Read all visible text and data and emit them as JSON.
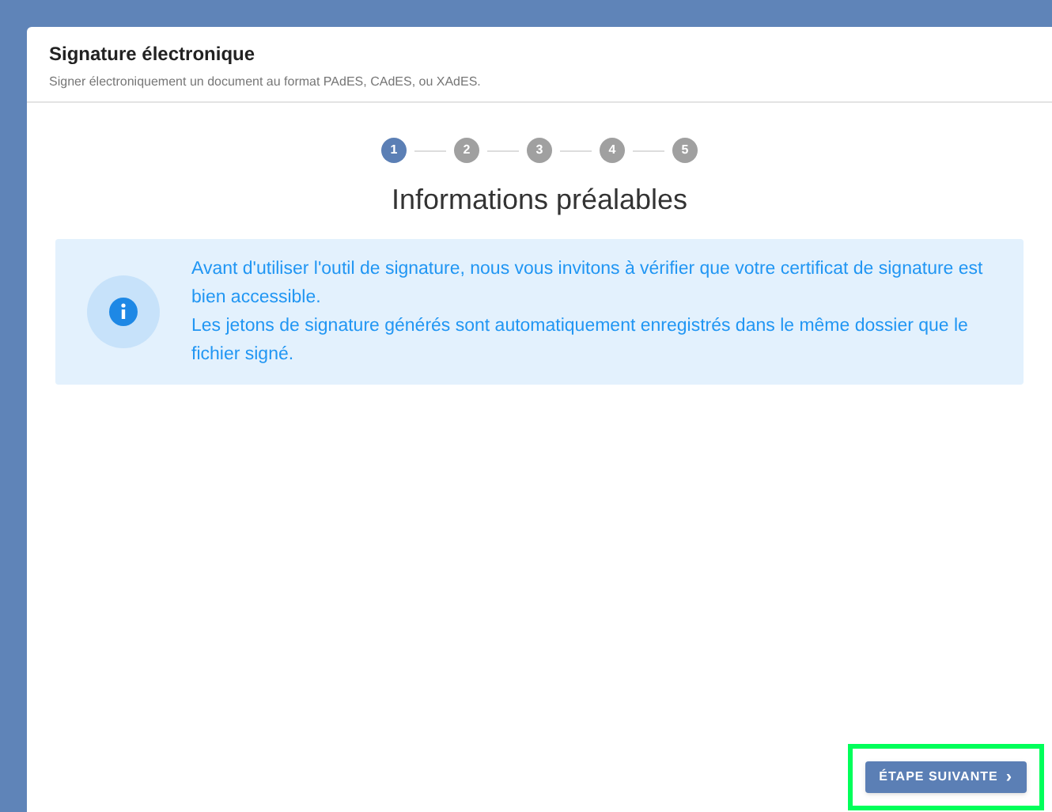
{
  "panel": {
    "title": "Signature électronique",
    "subtitle": "Signer électroniquement un document au format PAdES, CAdES, ou XAdES."
  },
  "steps": [
    {
      "label": "1",
      "selected": true
    },
    {
      "label": "2",
      "selected": false
    },
    {
      "label": "3",
      "selected": false
    },
    {
      "label": "4",
      "selected": false
    },
    {
      "label": "5",
      "selected": false
    }
  ],
  "step_title": "Informations préalables",
  "info": {
    "lines": [
      "Avant d'utiliser l'outil de signature, nous vous invitons à vérifier que votre certificat de signature est bien accessible.",
      "Les jetons de signature générés sont automatiquement enregistrés dans le même dossier que le fichier signé."
    ]
  },
  "next_button": {
    "label": "ÉTAPE SUIVANTE",
    "icon": "›",
    "highlighted": true
  }
}
